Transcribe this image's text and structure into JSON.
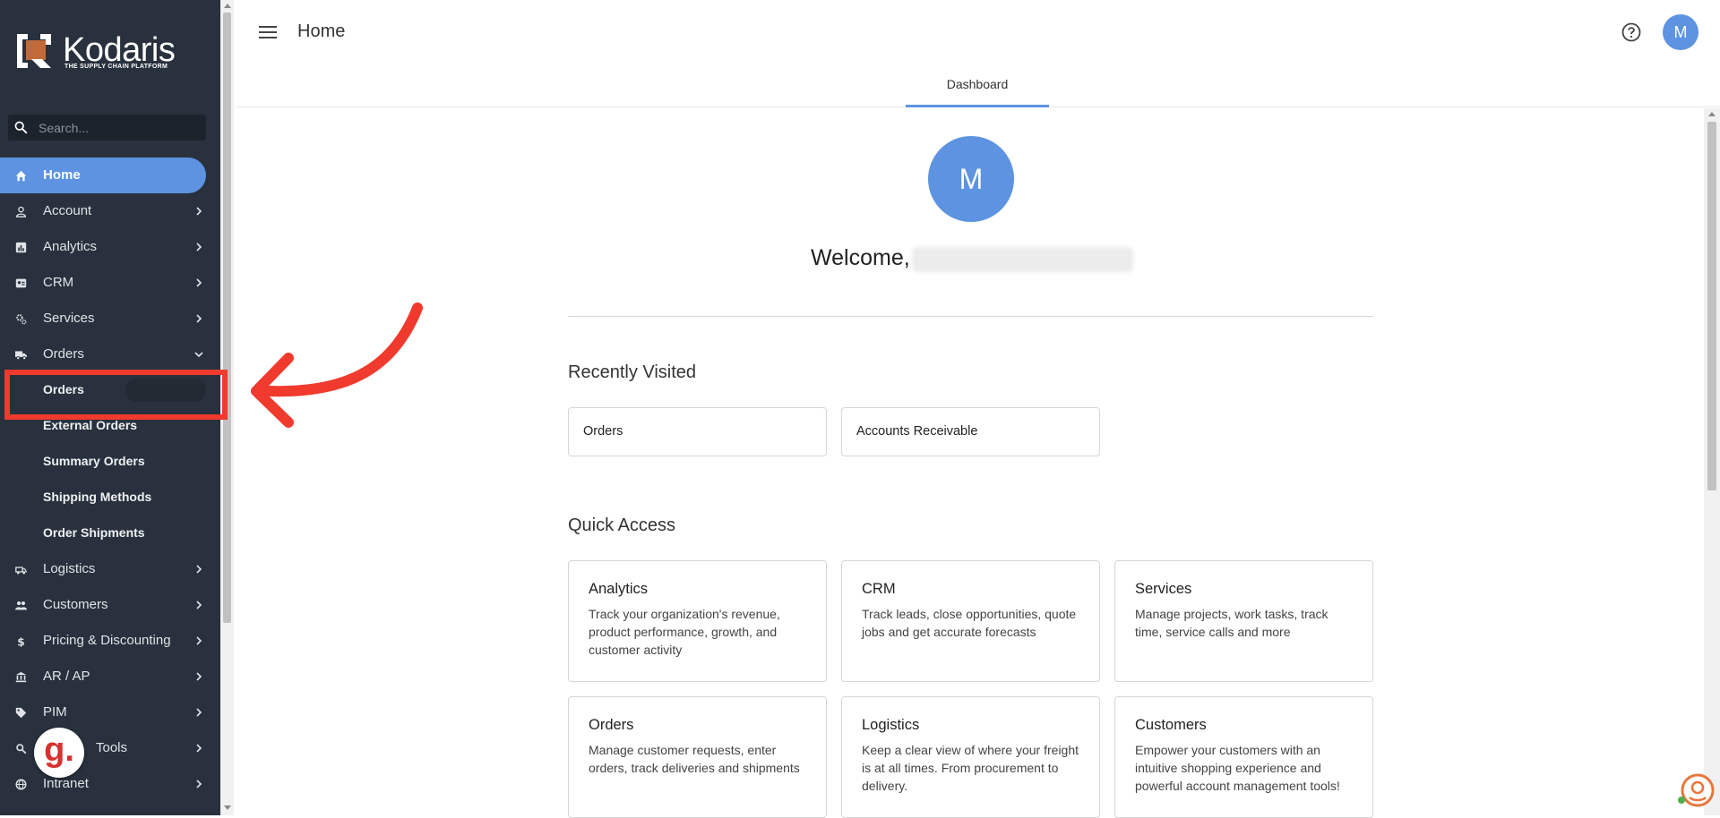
{
  "sidebar": {
    "logo_text": "Kodaris",
    "logo_subtitle": "THE SUPPLY CHAIN PLATFORM",
    "search_placeholder": "Search...",
    "items": [
      {
        "label": "Home",
        "icon": "home-icon",
        "active": true
      },
      {
        "label": "Account",
        "icon": "account-icon"
      },
      {
        "label": "Analytics",
        "icon": "analytics-icon"
      },
      {
        "label": "CRM",
        "icon": "crm-icon"
      },
      {
        "label": "Services",
        "icon": "services-icon"
      },
      {
        "label": "Orders",
        "icon": "truck-icon",
        "expanded": true
      },
      {
        "label": "Logistics",
        "icon": "logistics-icon"
      },
      {
        "label": "Customers",
        "icon": "customers-icon"
      },
      {
        "label": "Pricing & Discounting",
        "icon": "dollar-icon"
      },
      {
        "label": "AR / AP",
        "icon": "bank-icon"
      },
      {
        "label": "PIM",
        "icon": "tag-icon"
      },
      {
        "label": "Tools",
        "icon": "search-icon"
      },
      {
        "label": "Intranet",
        "icon": "intranet-icon"
      }
    ],
    "orders_subitems": [
      {
        "label": "Orders"
      },
      {
        "label": "External Orders"
      },
      {
        "label": "Summary Orders"
      },
      {
        "label": "Shipping Methods"
      },
      {
        "label": "Order Shipments"
      }
    ]
  },
  "guide_badge": "g.",
  "header": {
    "title": "Home",
    "avatar_initial": "M",
    "tabs": [
      {
        "label": "Dashboard"
      }
    ]
  },
  "main": {
    "avatar_initial": "M",
    "welcome": "Welcome,",
    "recently_visited": {
      "title": "Recently Visited",
      "items": [
        "Orders",
        "Accounts Receivable"
      ]
    },
    "quick_access": {
      "title": "Quick Access",
      "cards": [
        {
          "title": "Analytics",
          "desc": "Track your organization's revenue, product performance, growth, and customer activity"
        },
        {
          "title": "CRM",
          "desc": "Track leads, close opportunities, quote jobs and get accurate forecasts"
        },
        {
          "title": "Services",
          "desc": "Manage projects, work tasks, track time, service calls and more"
        },
        {
          "title": "Orders",
          "desc": "Manage customer requests, enter orders, track deliveries and shipments"
        },
        {
          "title": "Logistics",
          "desc": "Keep a clear view of where your freight is at all times. From procurement to delivery."
        },
        {
          "title": "Customers",
          "desc": "Empower your customers with an intuitive shopping experience and powerful account management tools!"
        }
      ]
    }
  },
  "colors": {
    "sidebar_bg": "#28313d",
    "accent": "#5d93e0",
    "annotation_red": "#f03a2d"
  }
}
